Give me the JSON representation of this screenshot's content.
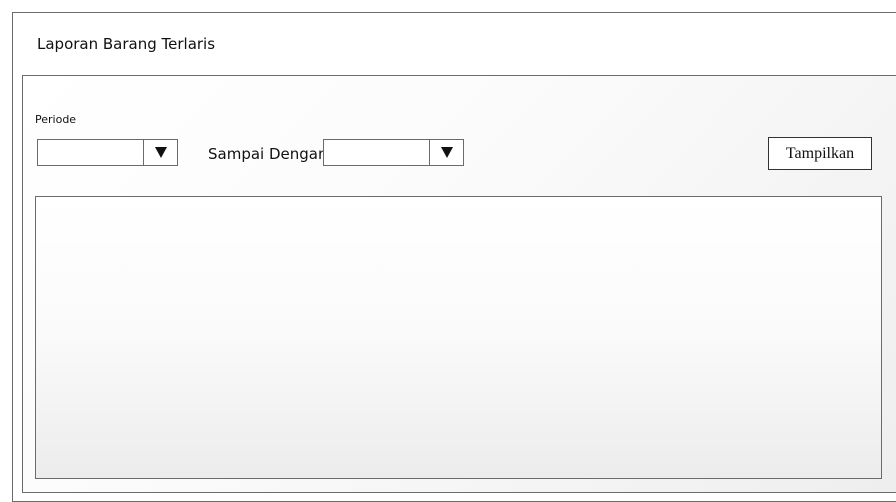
{
  "window": {
    "title": "Laporan Barang Terlaris"
  },
  "filter": {
    "periode_label": "Periode",
    "start_select": {
      "value": ""
    },
    "sampai_label": "Sampai Dengan",
    "end_select": {
      "value": ""
    },
    "dropdown_icon": "triangle-down-icon",
    "show_button_label": "Tampilkan"
  },
  "report": {
    "rows": []
  }
}
